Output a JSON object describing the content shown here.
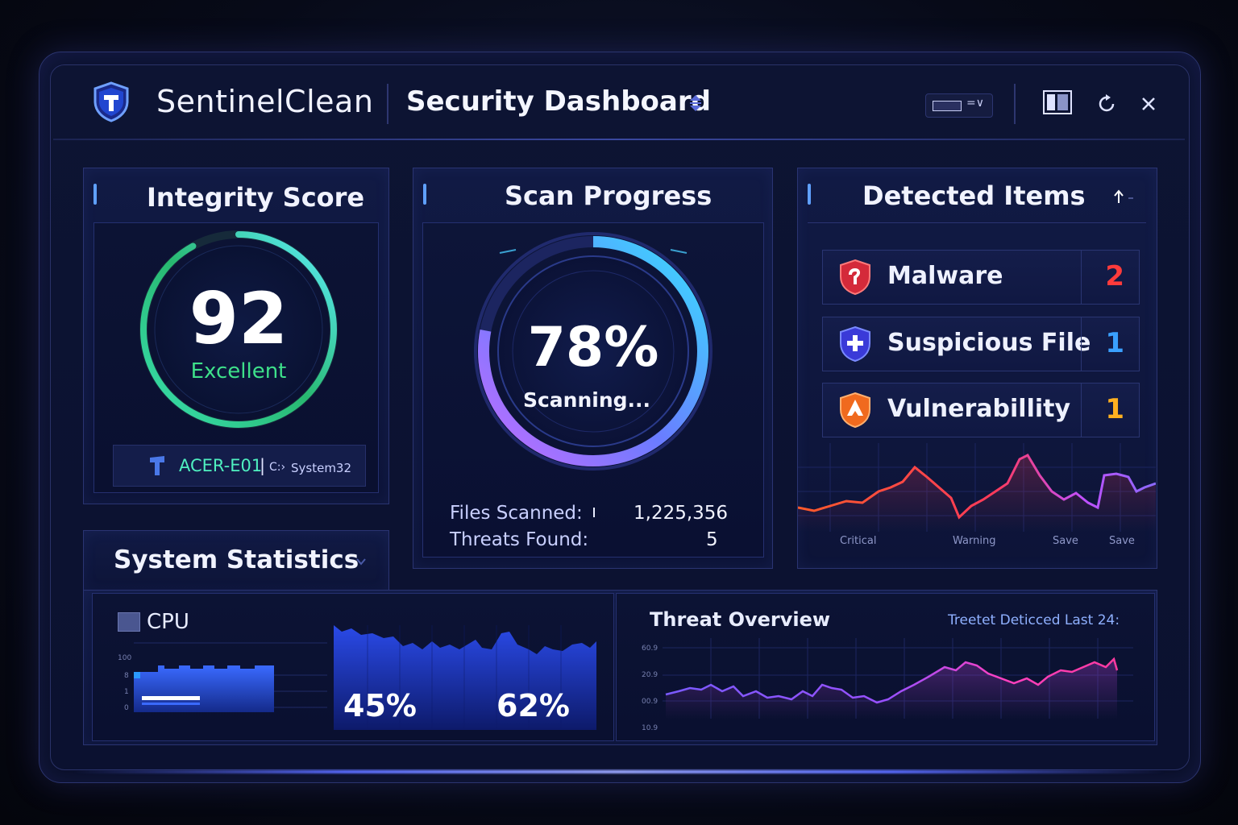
{
  "app": {
    "brand": "SentinelClean",
    "page_title": "Security Dashboard"
  },
  "header": {
    "view_selector_label": "=∨",
    "icons": [
      "panel-icon",
      "refresh-icon",
      "close-icon"
    ]
  },
  "integrity": {
    "title": "Integrity Score",
    "score": "92",
    "rating": "Excellent",
    "ring_fraction": 0.92,
    "device": "ACER-E01",
    "path_drive": "C:›",
    "path_folder": "System32"
  },
  "scan": {
    "title": "Scan Progress",
    "percent_text": "78%",
    "progress_fraction": 0.78,
    "status": "Scanning...",
    "files_label": "Files Scanned:",
    "files_value": "1,225,356",
    "threats_label": "Threats Found:",
    "threats_value": "5"
  },
  "detected": {
    "title": "Detected Items",
    "items": [
      {
        "label": "Malware",
        "count": "2",
        "color": "#ff3b3b"
      },
      {
        "label": "Suspicious File",
        "count": "1",
        "color": "#3aa0ff"
      },
      {
        "label": "Vulnerabillity",
        "count": "1",
        "color": "#ffb020"
      }
    ],
    "chart_labels": [
      "Critical",
      "Warning",
      "Save",
      "Save"
    ]
  },
  "system": {
    "title": "System Statistics",
    "cpu_label": "CPU",
    "axis_ticks": [
      "100",
      "8",
      "1",
      "0"
    ],
    "cpu_percent": "45%",
    "other_percent": "62%"
  },
  "threat_overview": {
    "title": "Threat Overview",
    "subtitle": "Treetet Deticced Last 24:",
    "y_ticks": [
      "60.9",
      "20.9",
      "00.9",
      "10.9"
    ]
  },
  "colors": {
    "accent": "#5a6cff",
    "green": "#3ee08a",
    "cyan": "#39d0ff",
    "purple": "#a05cff",
    "red": "#ff3b3b"
  }
}
